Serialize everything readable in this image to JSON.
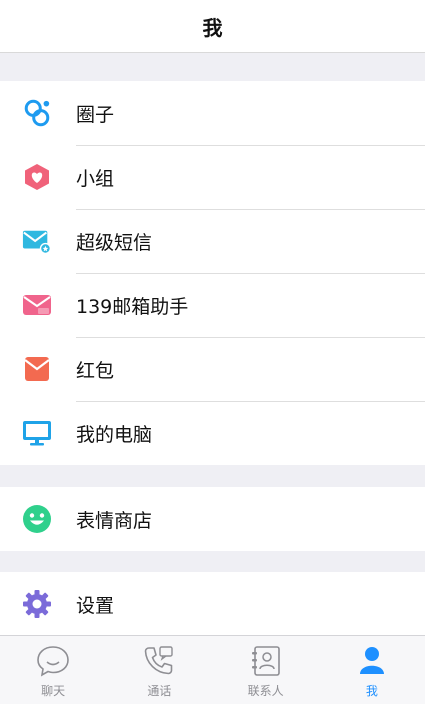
{
  "header": {
    "title": "我"
  },
  "groups": [
    {
      "items": [
        {
          "label": "圈子",
          "icon": "circles-icon"
        },
        {
          "label": "小组",
          "icon": "group-hexagon-icon"
        },
        {
          "label": "超级短信",
          "icon": "super-sms-icon"
        },
        {
          "label": "139邮箱助手",
          "icon": "mail-139-icon"
        },
        {
          "label": "红包",
          "icon": "red-envelope-icon"
        },
        {
          "label": "我的电脑",
          "icon": "computer-monitor-icon"
        }
      ]
    },
    {
      "items": [
        {
          "label": "表情商店",
          "icon": "smiley-face-icon"
        }
      ]
    },
    {
      "items": [
        {
          "label": "设置",
          "icon": "gear-icon"
        }
      ]
    }
  ],
  "tabbar": {
    "tabs": [
      {
        "label": "聊天",
        "icon": "chat-bubble-icon",
        "active": false
      },
      {
        "label": "通话",
        "icon": "phone-icon",
        "active": false
      },
      {
        "label": "联系人",
        "icon": "contacts-book-icon",
        "active": false
      },
      {
        "label": "我",
        "icon": "person-icon",
        "active": true
      }
    ]
  },
  "colors": {
    "accent": "#1e90ff",
    "circles": "#1e9bf0",
    "group": "#f0627a",
    "super_sms": "#2fb8e0",
    "mail_139": "#f0648c",
    "red_envelope": "#f36a50",
    "computer": "#1fa3e8",
    "smiley": "#2fd08c",
    "gear": "#7b6bd9"
  }
}
